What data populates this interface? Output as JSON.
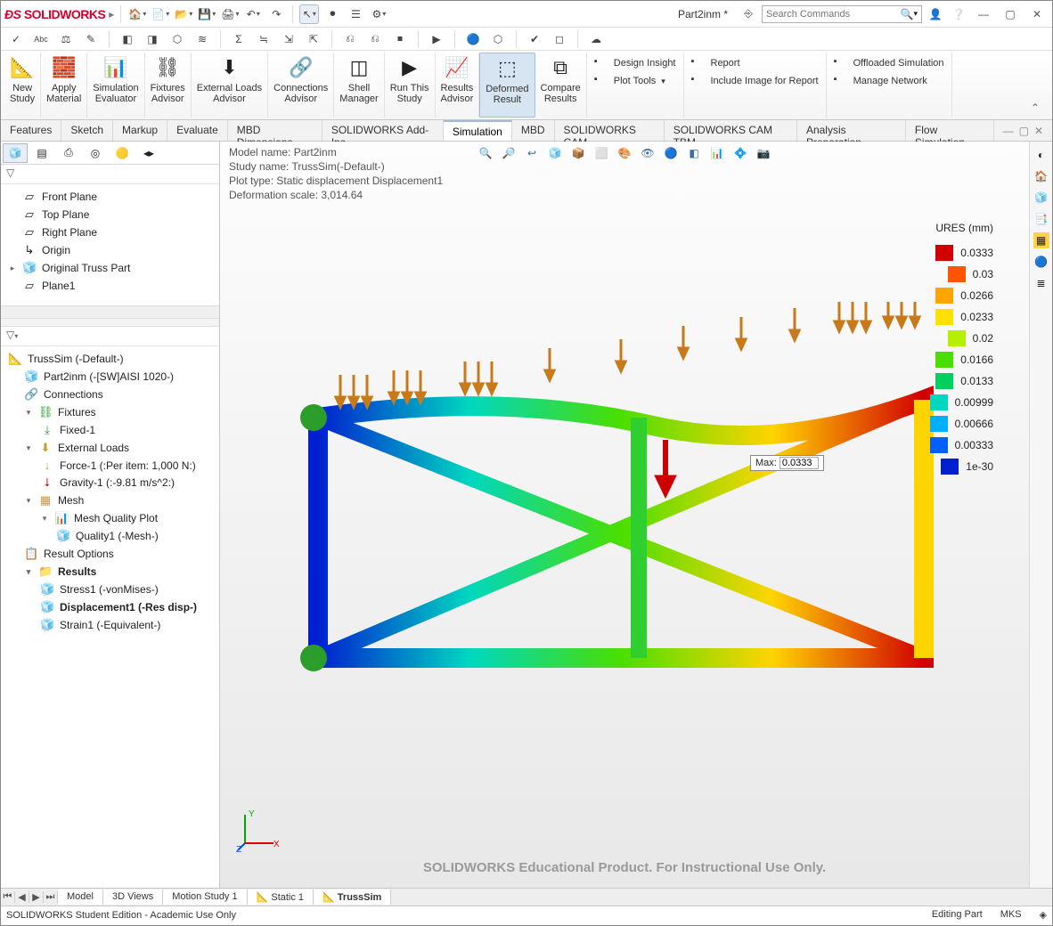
{
  "app": {
    "name": "SOLIDWORKS",
    "doc": "Part2inm *"
  },
  "search": {
    "placeholder": "Search Commands"
  },
  "ribbon_buttons": [
    {
      "label": "New\nStudy",
      "id": "new-study"
    },
    {
      "label": "Apply\nMaterial",
      "id": "apply-material"
    },
    {
      "label": "Simulation\nEvaluator",
      "id": "sim-eval"
    },
    {
      "label": "Fixtures\nAdvisor",
      "id": "fixtures"
    },
    {
      "label": "External Loads\nAdvisor",
      "id": "ext-loads"
    },
    {
      "label": "Connections\nAdvisor",
      "id": "connections"
    },
    {
      "label": "Shell\nManager",
      "id": "shell-mgr"
    },
    {
      "label": "Run This\nStudy",
      "id": "run"
    },
    {
      "label": "Results\nAdvisor",
      "id": "results-adv"
    },
    {
      "label": "Deformed\nResult",
      "id": "deformed",
      "sel": true
    },
    {
      "label": "Compare\nResults",
      "id": "compare"
    }
  ],
  "ribbon_side": [
    [
      "Design Insight",
      "Plot Tools"
    ],
    [
      "Report",
      "Include Image for Report"
    ],
    [
      "Offloaded Simulation",
      "Manage Network"
    ]
  ],
  "ribbon_tabs": [
    "Features",
    "Sketch",
    "Markup",
    "Evaluate",
    "MBD Dimensions",
    "SOLIDWORKS Add-Ins",
    "Simulation",
    "MBD",
    "SOLIDWORKS CAM",
    "SOLIDWORKS CAM TBM",
    "Analysis Preparation",
    "Flow Simulation"
  ],
  "ribbon_active": "Simulation",
  "feature_tree": {
    "items": [
      "Front Plane",
      "Top Plane",
      "Right Plane",
      "Origin",
      "Original Truss Part",
      "Plane1"
    ]
  },
  "study_tree": {
    "root": "TrussSim (-Default-)",
    "part": "Part2inm (-[SW]AISI 1020-)",
    "connections": "Connections",
    "fixtures": "Fixtures",
    "fixed": "Fixed-1",
    "loads": "External Loads",
    "force": "Force-1 (:Per item: 1,000 N:)",
    "gravity": "Gravity-1 (:-9.81 m/s^2:)",
    "mesh": "Mesh",
    "mqp": "Mesh Quality Plot",
    "quality": "Quality1 (-Mesh-)",
    "resopt": "Result Options",
    "results": "Results",
    "stress": "Stress1 (-vonMises-)",
    "disp": "Displacement1 (-Res disp-)",
    "strain": "Strain1 (-Equivalent-)"
  },
  "plot_info": {
    "l1": "Model name: Part2inm",
    "l2": "Study name: TrussSim(-Default-)",
    "l3": "Plot type: Static displacement Displacement1",
    "l4": "Deformation scale: 3,014.64"
  },
  "legend": {
    "title": "URES (mm)",
    "max_label": "Max:",
    "max_val": "0.0333",
    "vals": [
      "0.0333",
      "0.03",
      "0.0266",
      "0.0233",
      "0.02",
      "0.0166",
      "0.0133",
      "0.00999",
      "0.00666",
      "0.00333",
      "1e-30"
    ],
    "colors": [
      "#d10000",
      "#ff5500",
      "#ffa500",
      "#ffe000",
      "#b6ef00",
      "#4ade00",
      "#00d060",
      "#00d7c0",
      "#00b0ff",
      "#0060ff",
      "#0020d0"
    ]
  },
  "watermark": "SOLIDWORKS Educational Product. For Instructional Use Only.",
  "bottom_tabs": [
    "Model",
    "3D Views",
    "Motion Study 1",
    "Static 1",
    "TrussSim"
  ],
  "bottom_active": "TrussSim",
  "status": {
    "left": "SOLIDWORKS Student Edition - Academic Use Only",
    "right1": "Editing Part",
    "right2": "MKS"
  },
  "chart_data": {
    "type": "contour-legend",
    "title": "URES (mm)",
    "values": [
      0.0333,
      0.03,
      0.0266,
      0.0233,
      0.02,
      0.0166,
      0.0133,
      0.00999,
      0.00666,
      0.00333,
      1e-30
    ],
    "max_annotation": 0.0333,
    "model": "Part2inm",
    "study": "TrussSim(-Default-)",
    "plot": "Static displacement Displacement1",
    "deformation_scale": 3014.64
  }
}
